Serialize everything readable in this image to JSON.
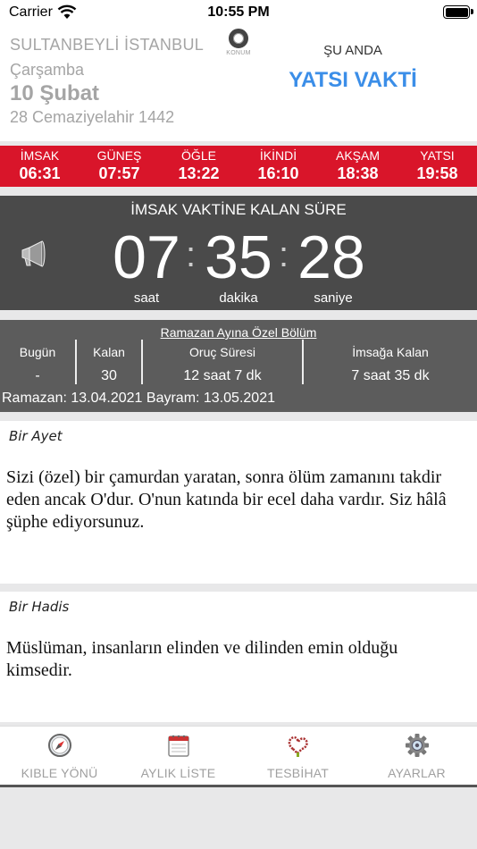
{
  "status": {
    "carrier": "Carrier",
    "time": "10:55 PM"
  },
  "header": {
    "location": "SULTANBEYLİ İSTANBUL",
    "day": "Çarşamba",
    "date": "10 Şubat",
    "hijri": "28 Cemaziyelahir 1442",
    "konum_label": "KONUM",
    "now_label": "ŞU ANDA",
    "current_vakit": "YATSI VAKTİ",
    "accent": "#3b8ee8"
  },
  "times": [
    {
      "name": "İMSAK",
      "time": "06:31"
    },
    {
      "name": "GÜNEŞ",
      "time": "07:57"
    },
    {
      "name": "ÖĞLE",
      "time": "13:22"
    },
    {
      "name": "İKİNDİ",
      "time": "16:10"
    },
    {
      "name": "AKŞAM",
      "time": "18:38"
    },
    {
      "name": "YATSI",
      "time": "19:58"
    }
  ],
  "times_bar_color": "#d9152a",
  "countdown": {
    "title": "İMSAK VAKTİNE KALAN SÜRE",
    "hours": "07",
    "minutes": "35",
    "seconds": "28",
    "hours_label": "saat",
    "minutes_label": "dakika",
    "seconds_label": "saniye",
    "icon": "speaker-icon"
  },
  "ramazan": {
    "title": "Ramazan Ayına Özel Bölüm",
    "columns": [
      {
        "header": "Bugün",
        "value": "-"
      },
      {
        "header": "Kalan",
        "value": "30"
      },
      {
        "header": "Oruç Süresi",
        "value": "12 saat 7 dk"
      },
      {
        "header": "İmsağa Kalan",
        "value": "7 saat 35 dk"
      }
    ],
    "dates": "Ramazan: 13.04.2021 Bayram: 13.05.2021"
  },
  "ayet": {
    "heading": "Bir Ayet",
    "text": "Sizi (özel) bir çamurdan yaratan, sonra ölüm zamanını takdir eden ancak O'dur. O'nun katında bir ecel daha vardır. Siz hâlâ şüphe ediyorsunuz."
  },
  "hadis": {
    "heading": "Bir Hadis",
    "text": "Müslüman, insanların elinden ve dilinden emin olduğu kimsedir."
  },
  "tabs": [
    {
      "label": "KIBLE YÖNÜ",
      "icon": "compass-icon"
    },
    {
      "label": "AYLIK LİSTE",
      "icon": "calendar-icon"
    },
    {
      "label": "TESBİHAT",
      "icon": "prayer-beads-icon"
    },
    {
      "label": "AYARLAR",
      "icon": "gear-icon"
    }
  ]
}
